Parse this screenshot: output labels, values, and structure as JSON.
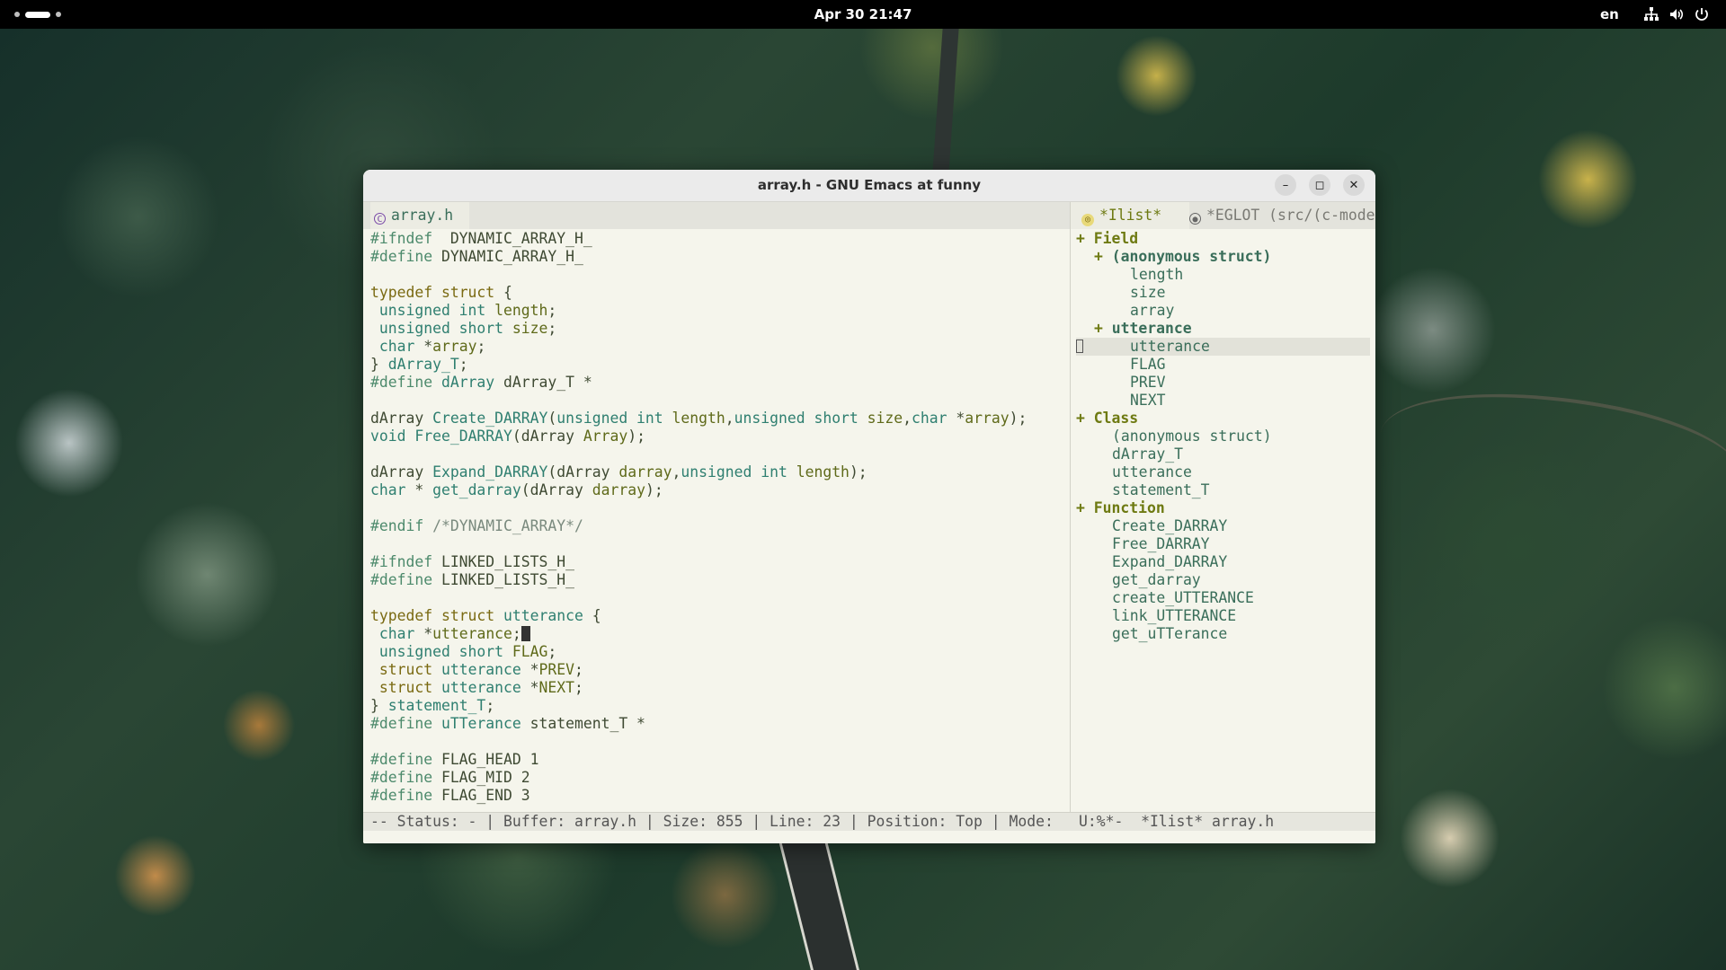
{
  "topbar": {
    "clock": "Apr 30  21:47",
    "language": "en",
    "tray_icons": [
      "network-icon",
      "volume-icon",
      "power-icon"
    ]
  },
  "window": {
    "title": "array.h - GNU Emacs at funny",
    "buttons": {
      "minimize": "–",
      "maximize": "◻",
      "close": "✕"
    }
  },
  "left_pane": {
    "tab": {
      "icon": "C",
      "label": "array.h"
    }
  },
  "right_pane": {
    "tabs": [
      {
        "label": "*Ilist*",
        "active": true
      },
      {
        "label": "*EGLOT (src/(c-mode",
        "active": false
      }
    ],
    "tree": [
      {
        "text": "Field",
        "kind": "cat",
        "indent": 0,
        "plus": true
      },
      {
        "text": "(anonymous struct)",
        "kind": "sub",
        "indent": 1,
        "plus": true
      },
      {
        "text": "length",
        "kind": "item",
        "indent": 2
      },
      {
        "text": "size",
        "kind": "item",
        "indent": 2
      },
      {
        "text": "array",
        "kind": "item",
        "indent": 2
      },
      {
        "text": "utterance",
        "kind": "sub",
        "indent": 1,
        "plus": true
      },
      {
        "text": "utterance",
        "kind": "item",
        "indent": 2,
        "highlight": true
      },
      {
        "text": "FLAG",
        "kind": "item",
        "indent": 2
      },
      {
        "text": "PREV",
        "kind": "item",
        "indent": 2
      },
      {
        "text": "NEXT",
        "kind": "item",
        "indent": 2
      },
      {
        "text": "Class",
        "kind": "cat",
        "indent": 0,
        "plus": true
      },
      {
        "text": "(anonymous struct)",
        "kind": "item",
        "indent": 1
      },
      {
        "text": "dArray_T",
        "kind": "item",
        "indent": 1
      },
      {
        "text": "utterance",
        "kind": "item",
        "indent": 1
      },
      {
        "text": "statement_T",
        "kind": "item",
        "indent": 1
      },
      {
        "text": "Function",
        "kind": "cat",
        "indent": 0,
        "plus": true
      },
      {
        "text": "Create_DARRAY",
        "kind": "item",
        "indent": 1
      },
      {
        "text": "Free_DARRAY",
        "kind": "item",
        "indent": 1
      },
      {
        "text": "Expand_DARRAY",
        "kind": "item",
        "indent": 1
      },
      {
        "text": "get_darray",
        "kind": "item",
        "indent": 1
      },
      {
        "text": "create_UTTERANCE",
        "kind": "item",
        "indent": 1
      },
      {
        "text": "link_UTTERANCE",
        "kind": "item",
        "indent": 1
      },
      {
        "text": "get_uTTerance",
        "kind": "item",
        "indent": 1
      }
    ]
  },
  "code_lines": [
    [
      [
        "pp",
        "#ifndef"
      ],
      [
        "",
        "  DYNAMIC_ARRAY_H_"
      ]
    ],
    [
      [
        "pp",
        "#define"
      ],
      [
        "",
        " DYNAMIC_ARRAY_H_"
      ]
    ],
    [],
    [
      [
        "kw",
        "typedef"
      ],
      [
        "",
        " "
      ],
      [
        "kw",
        "struct"
      ],
      [
        "",
        " {"
      ]
    ],
    [
      [
        "",
        " "
      ],
      [
        "ty",
        "unsigned int"
      ],
      [
        "",
        " "
      ],
      [
        "vn",
        "length"
      ],
      [
        "",
        ";"
      ]
    ],
    [
      [
        "",
        " "
      ],
      [
        "ty",
        "unsigned short"
      ],
      [
        "",
        " "
      ],
      [
        "vn",
        "size"
      ],
      [
        "",
        ";"
      ]
    ],
    [
      [
        "",
        " "
      ],
      [
        "ty",
        "char"
      ],
      [
        "",
        " *"
      ],
      [
        "vn",
        "array"
      ],
      [
        "",
        ";"
      ]
    ],
    [
      [
        "",
        "} "
      ],
      [
        "ty",
        "dArray_T"
      ],
      [
        "",
        ";"
      ]
    ],
    [
      [
        "pp",
        "#define"
      ],
      [
        "",
        " "
      ],
      [
        "fn",
        "dArray"
      ],
      [
        "",
        " dArray_T *"
      ]
    ],
    [],
    [
      [
        "",
        "dArray "
      ],
      [
        "fn",
        "Create_DARRAY"
      ],
      [
        "",
        "("
      ],
      [
        "ty",
        "unsigned int"
      ],
      [
        "",
        " "
      ],
      [
        "vn",
        "length"
      ],
      [
        "",
        ","
      ],
      [
        "ty",
        "unsigned short"
      ],
      [
        "",
        " "
      ],
      [
        "vn",
        "size"
      ],
      [
        "",
        ","
      ],
      [
        "ty",
        "char"
      ],
      [
        "",
        " *"
      ],
      [
        "vn",
        "array"
      ],
      [
        "",
        ");"
      ]
    ],
    [
      [
        "ty",
        "void"
      ],
      [
        "",
        " "
      ],
      [
        "fn",
        "Free_DARRAY"
      ],
      [
        "",
        "(dArray "
      ],
      [
        "vn",
        "Array"
      ],
      [
        "",
        ");"
      ]
    ],
    [],
    [
      [
        "",
        "dArray "
      ],
      [
        "fn",
        "Expand_DARRAY"
      ],
      [
        "",
        "(dArray "
      ],
      [
        "vn",
        "darray"
      ],
      [
        "",
        ","
      ],
      [
        "ty",
        "unsigned int"
      ],
      [
        "",
        " "
      ],
      [
        "vn",
        "length"
      ],
      [
        "",
        ");"
      ]
    ],
    [
      [
        "ty",
        "char"
      ],
      [
        "",
        " * "
      ],
      [
        "fn",
        "get_darray"
      ],
      [
        "",
        "(dArray "
      ],
      [
        "vn",
        "darray"
      ],
      [
        "",
        ");"
      ]
    ],
    [],
    [
      [
        "pp",
        "#endif"
      ],
      [
        "",
        " "
      ],
      [
        "cm",
        "/*DYNAMIC_ARRAY*/"
      ]
    ],
    [],
    [
      [
        "pp",
        "#ifndef"
      ],
      [
        "",
        " LINKED_LISTS_H_"
      ]
    ],
    [
      [
        "pp",
        "#define"
      ],
      [
        "",
        " LINKED_LISTS_H_"
      ]
    ],
    [],
    [
      [
        "kw",
        "typedef"
      ],
      [
        "",
        " "
      ],
      [
        "kw",
        "struct"
      ],
      [
        "",
        " "
      ],
      [
        "ty",
        "utterance"
      ],
      [
        "",
        " {"
      ]
    ],
    [
      [
        "",
        " "
      ],
      [
        "ty",
        "char"
      ],
      [
        "",
        " *"
      ],
      [
        "vn",
        "utterance"
      ],
      [
        "",
        ";"
      ],
      [
        "cursor",
        ""
      ]
    ],
    [
      [
        "",
        " "
      ],
      [
        "ty",
        "unsigned short"
      ],
      [
        "",
        " "
      ],
      [
        "vn",
        "FLAG"
      ],
      [
        "",
        ";"
      ]
    ],
    [
      [
        "",
        " "
      ],
      [
        "kw",
        "struct"
      ],
      [
        "",
        " "
      ],
      [
        "ty",
        "utterance"
      ],
      [
        "",
        " *"
      ],
      [
        "vn",
        "PREV"
      ],
      [
        "",
        ";"
      ]
    ],
    [
      [
        "",
        " "
      ],
      [
        "kw",
        "struct"
      ],
      [
        "",
        " "
      ],
      [
        "ty",
        "utterance"
      ],
      [
        "",
        " *"
      ],
      [
        "vn",
        "NEXT"
      ],
      [
        "",
        ";"
      ]
    ],
    [
      [
        "",
        "} "
      ],
      [
        "ty",
        "statement_T"
      ],
      [
        "",
        ";"
      ]
    ],
    [
      [
        "pp",
        "#define"
      ],
      [
        "",
        " "
      ],
      [
        "fn",
        "uTTerance"
      ],
      [
        "",
        " statement_T *"
      ]
    ],
    [],
    [
      [
        "pp",
        "#define"
      ],
      [
        "",
        " FLAG_HEAD 1"
      ]
    ],
    [
      [
        "pp",
        "#define"
      ],
      [
        "",
        " FLAG_MID 2"
      ]
    ],
    [
      [
        "pp",
        "#define"
      ],
      [
        "",
        " FLAG_END 3"
      ]
    ]
  ],
  "modeline": {
    "left": "-- Status: - | Buffer: array.h | Size: 855 | Line: 23 | Position: Top | Mode:",
    "right": "U:%*-  *Ilist* array.h"
  }
}
